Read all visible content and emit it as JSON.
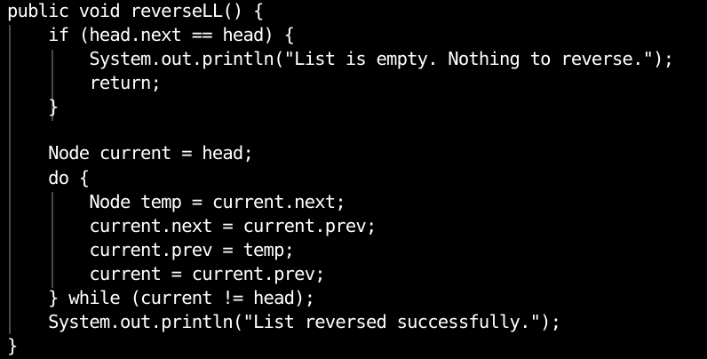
{
  "editor": {
    "background": "#000000",
    "text_color": "#ffffff",
    "lines": [
      "public void reverseLL() {",
      "    if (head.next == head) {",
      "        System.out.println(\"List is empty. Nothing to reverse.\");",
      "        return;",
      "    }",
      "",
      "    Node current = head;",
      "    do {",
      "        Node temp = current.next;",
      "        current.next = current.prev;",
      "        current.prev = temp;",
      "        current = current.prev;",
      "    } while (current != head);",
      "    System.out.println(\"List reversed successfully.\");",
      "}"
    ]
  }
}
